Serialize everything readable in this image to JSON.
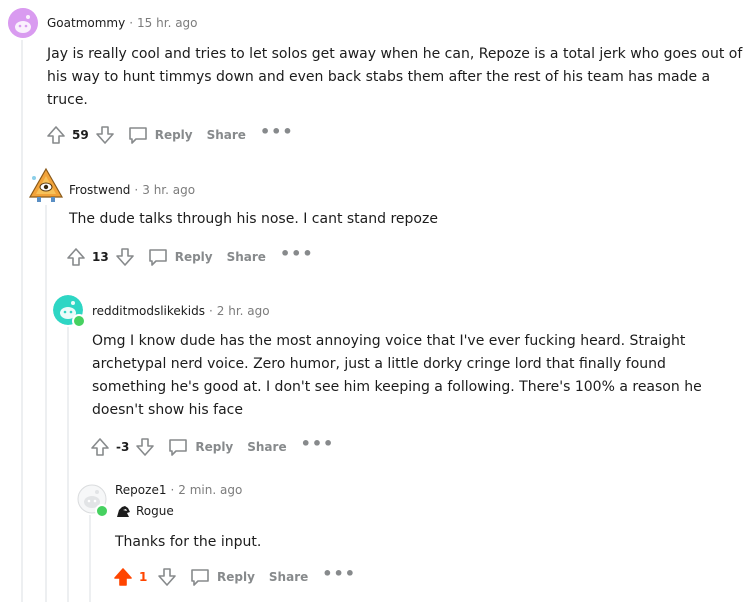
{
  "comments": [
    {
      "username": "Goatmommy",
      "time": "15 hr. ago",
      "text": "Jay is really cool and tries to let solos get away when he can, Repoze is a total jerk who goes out of his way to hunt timmys down and even back stabs them after the rest of his team has made a truce.",
      "score": "59",
      "reply_label": "Reply",
      "share_label": "Share",
      "more_label": "•••"
    },
    {
      "username": "Frostwend",
      "time": "3 hr. ago",
      "text": "The dude talks through his nose. I cant stand repoze",
      "score": "13",
      "reply_label": "Reply",
      "share_label": "Share",
      "more_label": "•••"
    },
    {
      "username": "redditmodslikekids",
      "time": "2 hr. ago",
      "text": "Omg I know dude has the most annoying voice that I've ever fucking heard. Straight archetypal nerd voice. Zero humor, just a little dorky cringe lord that finally found something he's good at. I don't see him keeping a following. There's 100% a reason he doesn't show his face",
      "score": "-3",
      "reply_label": "Reply",
      "share_label": "Share",
      "more_label": "•••"
    },
    {
      "username": "Repoze1",
      "time": "2 min. ago",
      "flair": "Rogue",
      "text": "Thanks for the input.",
      "score": "1",
      "reply_label": "Reply",
      "share_label": "Share",
      "more_label": "•••"
    }
  ],
  "meta_separator": "·",
  "colors": {
    "upvote_active": "#ff4500",
    "action_gray": "#878a8c",
    "thread_line": "#edeff1",
    "online": "#46d160"
  }
}
